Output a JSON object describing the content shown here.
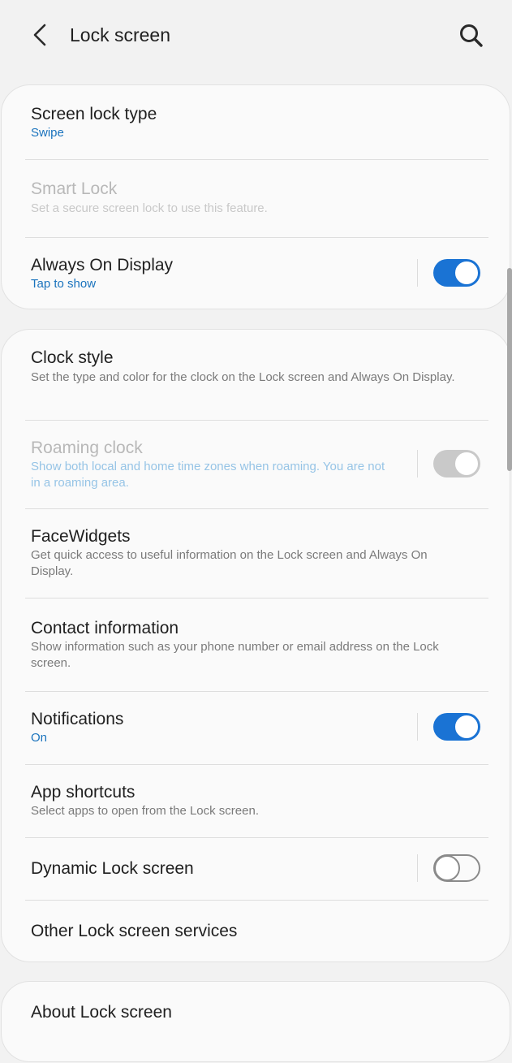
{
  "header": {
    "title": "Lock screen",
    "back_icon": "back-arrow-icon",
    "search_icon": "search-icon"
  },
  "card1": {
    "screen_lock_type": {
      "title": "Screen lock type",
      "value": "Swipe"
    },
    "smart_lock": {
      "title": "Smart Lock",
      "subtitle": "Set a secure screen lock to use this feature.",
      "enabled": false
    },
    "always_on_display": {
      "title": "Always On Display",
      "value": "Tap to show",
      "toggle": true
    }
  },
  "card2": {
    "clock_style": {
      "title": "Clock style",
      "subtitle": "Set the type and color for the clock on the Lock screen and Always On Display."
    },
    "roaming_clock": {
      "title": "Roaming clock",
      "subtitle": "Show both local and home time zones when roaming. You are not in a roaming area.",
      "toggle": true,
      "enabled": false
    },
    "facewidgets": {
      "title": "FaceWidgets",
      "subtitle": "Get quick access to useful information on the Lock screen and Always On Display."
    },
    "contact_information": {
      "title": "Contact information",
      "subtitle": "Show information such as your phone number or email address on the Lock screen."
    },
    "notifications": {
      "title": "Notifications",
      "value": "On",
      "toggle": true
    },
    "app_shortcuts": {
      "title": "App shortcuts",
      "subtitle": "Select apps to open from the Lock screen."
    },
    "dynamic_lock_screen": {
      "title": "Dynamic Lock screen",
      "toggle": false
    },
    "other_services": {
      "title": "Other Lock screen services"
    }
  },
  "card3": {
    "about": {
      "title": "About Lock screen"
    }
  },
  "colors": {
    "accent": "#1a73d4",
    "link_text": "#1a73bd",
    "background": "#f2f2f2",
    "card": "#fafafa"
  }
}
